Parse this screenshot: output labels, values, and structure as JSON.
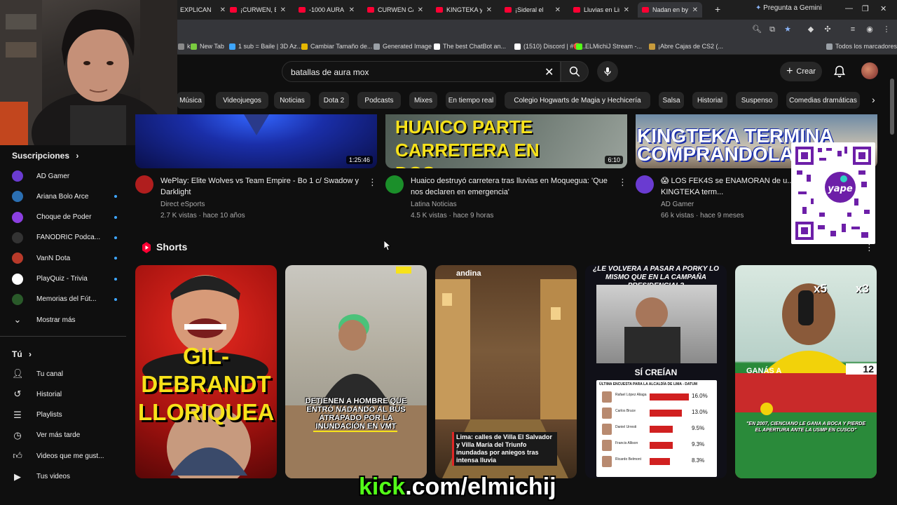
{
  "browser": {
    "tabs": [
      {
        "label": "EXPLICAN",
        "active": false
      },
      {
        "label": "¡CURWEN, EL",
        "active": false
      },
      {
        "label": "-1000 AURA -",
        "active": false
      },
      {
        "label": "CURWEN CAC",
        "active": false
      },
      {
        "label": "KINGTEKA y la",
        "active": false
      },
      {
        "label": "¡Sideral el",
        "active": false
      },
      {
        "label": "Lluvias en Lim",
        "active": false
      },
      {
        "label": "Nadan en by-",
        "active": true
      }
    ],
    "new_tab": "+",
    "gemini": "Pregunta a Gemini",
    "bookmarks": [
      {
        "label": "k",
        "color": "#8a8a8a"
      },
      {
        "label": "New Tab",
        "color": "#7acc3f"
      },
      {
        "label": "1 sub = Baile | 3D Az...",
        "color": "#3ea6ff"
      },
      {
        "label": "Cambiar Tamaño de...",
        "color": "#e6b800"
      },
      {
        "label": "Generated Image",
        "color": "#9aa0a6"
      },
      {
        "label": "The best ChatBot an...",
        "color": "#ffffff"
      },
      {
        "label": "(1510) Discord | #🔴...",
        "color": "#ffffff"
      },
      {
        "label": "ELMichiJ Stream -...",
        "color": "#53fc18"
      },
      {
        "label": "¡Abre Cajas de CS2 (...",
        "color": "#c89b3c"
      },
      {
        "label": "Todos los marcadores",
        "color": "#9aa0a6"
      }
    ]
  },
  "header": {
    "search_query": "batallas de aura mox",
    "create_label": "Crear"
  },
  "chips": [
    "Música",
    "Videojuegos",
    "Noticias",
    "Dota 2",
    "Podcasts",
    "Mixes",
    "En tiempo real",
    "Colegio Hogwarts de Magia y Hechicería",
    "Salsa",
    "Historial",
    "Suspenso",
    "Comedias dramáticas"
  ],
  "sidebar": {
    "subs_heading": "Suscripciones",
    "subs": [
      {
        "label": "AD Gamer",
        "color": "#6a3bd1",
        "dot": false
      },
      {
        "label": "Ariana Bolo Arce",
        "color": "#2b6fb2",
        "dot": true
      },
      {
        "label": "Choque de Poder",
        "color": "#8b3fe0",
        "dot": true
      },
      {
        "label": "FANODRIC Podca...",
        "color": "#333333",
        "dot": true
      },
      {
        "label": "VanN Dota",
        "color": "#b83a2a",
        "dot": true
      },
      {
        "label": "PlayQuiz - Trivia",
        "color": "#ffffff",
        "dot": true
      },
      {
        "label": "Memorias del Fút...",
        "color": "#2a5a2a",
        "dot": true
      }
    ],
    "show_more": "Mostrar más",
    "you_heading": "Tú",
    "you_items": [
      {
        "label": "Tu canal",
        "icon": "person-icon"
      },
      {
        "label": "Historial",
        "icon": "history-icon"
      },
      {
        "label": "Playlists",
        "icon": "playlist-icon"
      },
      {
        "label": "Ver más tarde",
        "icon": "clock-icon"
      },
      {
        "label": "Videos que me gust...",
        "icon": "thumb-up-icon"
      },
      {
        "label": "Tus videos",
        "icon": "video-icon"
      }
    ]
  },
  "videos": [
    {
      "thumb_text": "",
      "duration": "1:25:46",
      "title": "WePlay: Elite Wolves vs Team Empire  - Bo 1 c/ Swadow y Darklight",
      "channel": "Direct eSports",
      "meta": "2.7 K vistas · hace 10 años",
      "avatar_color": "#b01e1e"
    },
    {
      "thumb_text": "HUAICO PARTE CARRETERA EN DOS",
      "duration": "6:10",
      "title": "Huaico destruyó carretera tras lluvias en Moquegua: 'Que nos declaren en emergencia'",
      "channel": "Latina Noticias",
      "meta": "4.5 K vistas · hace 9 horas",
      "avatar_color": "#1b8f2a"
    },
    {
      "thumb_text": "KINGTEKA TERMINA COMPRANDOLA",
      "duration": "",
      "title": "😱 LOS FEK4S se ENAMORAN de u... 🚌 de $27,000 💸 y KINGTEKA term...",
      "channel": "AD Gamer",
      "meta": "66 k vistas · hace 9 meses",
      "avatar_color": "#6a3bd1"
    }
  ],
  "shorts": {
    "heading": "Shorts",
    "items": [
      {
        "caption": "GIL-DEBRANDT LLORIQUEA"
      },
      {
        "caption": "DETIENEN A HOMBRE QUE ENTRÓ NADANDO AL BUS ATRAPADO POR LA INUNDACIÓN EN VMT"
      },
      {
        "caption": "Lima: calles de Villa El Salvador y Villa María del Triunfo inundadas por aniegos tras intensa lluvia",
        "brand": "andina"
      },
      {
        "caption": "¿LE VOLVERÁ A PASAR A PORKY LO MISMO QUE EN LA CAMPAÑA PRESIDENCIAL?",
        "sub": "SÍ CREÍAN",
        "poll_title": "ÚLTIMA ENCUESTA PARA LA ALCALDÍA DE LIMA - DATUM",
        "poll": [
          {
            "name": "Rafael López Aliaga",
            "pct": "16.0%",
            "value": 16.0
          },
          {
            "name": "Carlos Bruce",
            "pct": "13.0%",
            "value": 13.0
          },
          {
            "name": "Daniel Urresti",
            "pct": "9.5%",
            "value": 9.5
          },
          {
            "name": "Francis Allison",
            "pct": "9.3%",
            "value": 9.3
          },
          {
            "name": "Ricardo Belmont",
            "pct": "8.3%",
            "value": 8.3
          }
        ]
      },
      {
        "caption": "\"EN 2007, CIENCIANO LE GANA A BOCA Y PIERDE EL APERTURA ANTE LA USMP EN CUSCO\"",
        "top_a": "GANÁS A",
        "x5": "x5",
        "x3": "x3",
        "num": "12"
      }
    ]
  },
  "overlay": {
    "kick_prefix": "kick",
    "kick_rest": ".com/elmichij",
    "qr_label": "yape"
  }
}
